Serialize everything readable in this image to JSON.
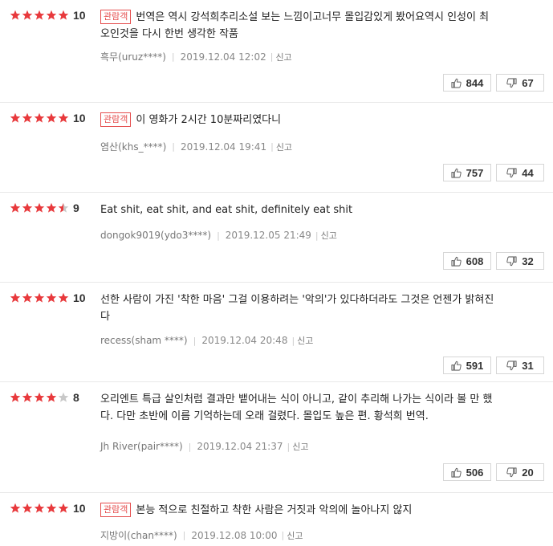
{
  "colors": {
    "star_on": "#e8393c",
    "star_off": "#c8c8c8",
    "badge": "#e54d4d"
  },
  "reviews": [
    {
      "rating": 10,
      "stars": [
        1,
        1,
        1,
        1,
        1
      ],
      "score": "10",
      "badge": "관람객",
      "text_lines": [
        "번역은 역시 강석희추리소설 보는 느낌이고너무 몰입감있게 봤어요역시 인성이 최",
        "오인것을 다시 한번 생각한 작품"
      ],
      "author": "흑무(uruz****)",
      "date": "2019.12.04 12:02",
      "report": "신고",
      "likes": "844",
      "dislikes": "67"
    },
    {
      "rating": 10,
      "stars": [
        1,
        1,
        1,
        1,
        1
      ],
      "score": "10",
      "badge": "관람객",
      "text_lines": [
        "이 영화가 2시간 10분짜리였다니"
      ],
      "author": "염산(khs_****)",
      "date": "2019.12.04 19:41",
      "report": "신고",
      "likes": "757",
      "dislikes": "44"
    },
    {
      "rating": 9,
      "stars": [
        1,
        1,
        1,
        1,
        0.5
      ],
      "score": "9",
      "badge": "",
      "text_lines": [
        "Eat shit, eat shit, and eat shit, definitely eat shit"
      ],
      "author": "dongok9019(ydo3****)",
      "date": "2019.12.05 21:49",
      "report": "신고",
      "likes": "608",
      "dislikes": "32"
    },
    {
      "rating": 10,
      "stars": [
        1,
        1,
        1,
        1,
        1
      ],
      "score": "10",
      "badge": "",
      "text_lines": [
        "선한 사람이 가진 '착한 마음' 그걸 이용하려는 '악의'가 있다하더라도 그것은 언젠가 밝혀진",
        "다"
      ],
      "author": "recess(sham ****)",
      "date": "2019.12.04 20:48",
      "report": "신고",
      "likes": "591",
      "dislikes": "31"
    },
    {
      "rating": 8,
      "stars": [
        1,
        1,
        1,
        1,
        0
      ],
      "score": "8",
      "badge": "",
      "text_lines": [
        "오리엔트 특급 살인처럼 결과만 뱉어내는 식이 아니고, 같이 추리해 나가는 식이라 볼 만 했",
        "다. 다만 초반에 이름 기억하는데 오래 걸렸다. 몰입도 높은 편. 황석희 번역."
      ],
      "author": "Jh River(pair****)",
      "date": "2019.12.04 21:37",
      "report": "신고",
      "likes": "506",
      "dislikes": "20"
    },
    {
      "rating": 10,
      "stars": [
        1,
        1,
        1,
        1,
        1
      ],
      "score": "10",
      "badge": "관람객",
      "text_lines": [
        "본능 적으로 친절하고 착한 사람은 거짓과 악의에 놀아나지 않지"
      ],
      "author": "지방이(chan****)",
      "date": "2019.12.08 10:00",
      "report": "신고",
      "likes": "",
      "dislikes": ""
    }
  ]
}
